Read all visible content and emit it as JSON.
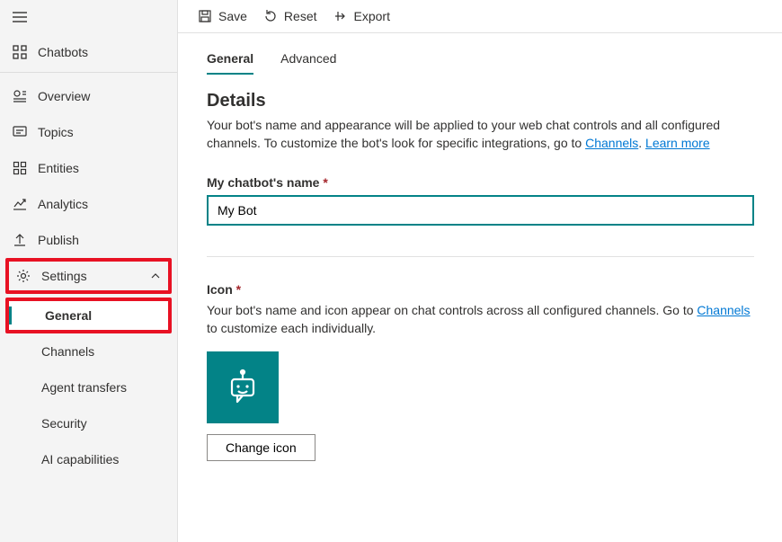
{
  "sidebar": {
    "chatbots": "Chatbots",
    "items": [
      {
        "label": "Overview"
      },
      {
        "label": "Topics"
      },
      {
        "label": "Entities"
      },
      {
        "label": "Analytics"
      },
      {
        "label": "Publish"
      },
      {
        "label": "Settings"
      }
    ],
    "settings_children": [
      {
        "label": "General"
      },
      {
        "label": "Channels"
      },
      {
        "label": "Agent transfers"
      },
      {
        "label": "Security"
      },
      {
        "label": "AI capabilities"
      }
    ]
  },
  "toolbar": {
    "save": "Save",
    "reset": "Reset",
    "export": "Export"
  },
  "tabs": {
    "general": "General",
    "advanced": "Advanced"
  },
  "details": {
    "title": "Details",
    "desc_pre": "Your bot's name and appearance will be applied to your web chat controls and all configured channels. To customize the bot's look for specific integrations, go to ",
    "channels_link": "Channels",
    "dot_space": ". ",
    "learn_more": "Learn more",
    "name_label": "My chatbot's name",
    "name_value": "My Bot"
  },
  "icon_section": {
    "label": "Icon",
    "desc_pre": "Your bot's name and icon appear on chat controls across all configured channels. Go to ",
    "channels_link": "Channels",
    "desc_post": " to customize each individually.",
    "change_btn": "Change icon"
  }
}
